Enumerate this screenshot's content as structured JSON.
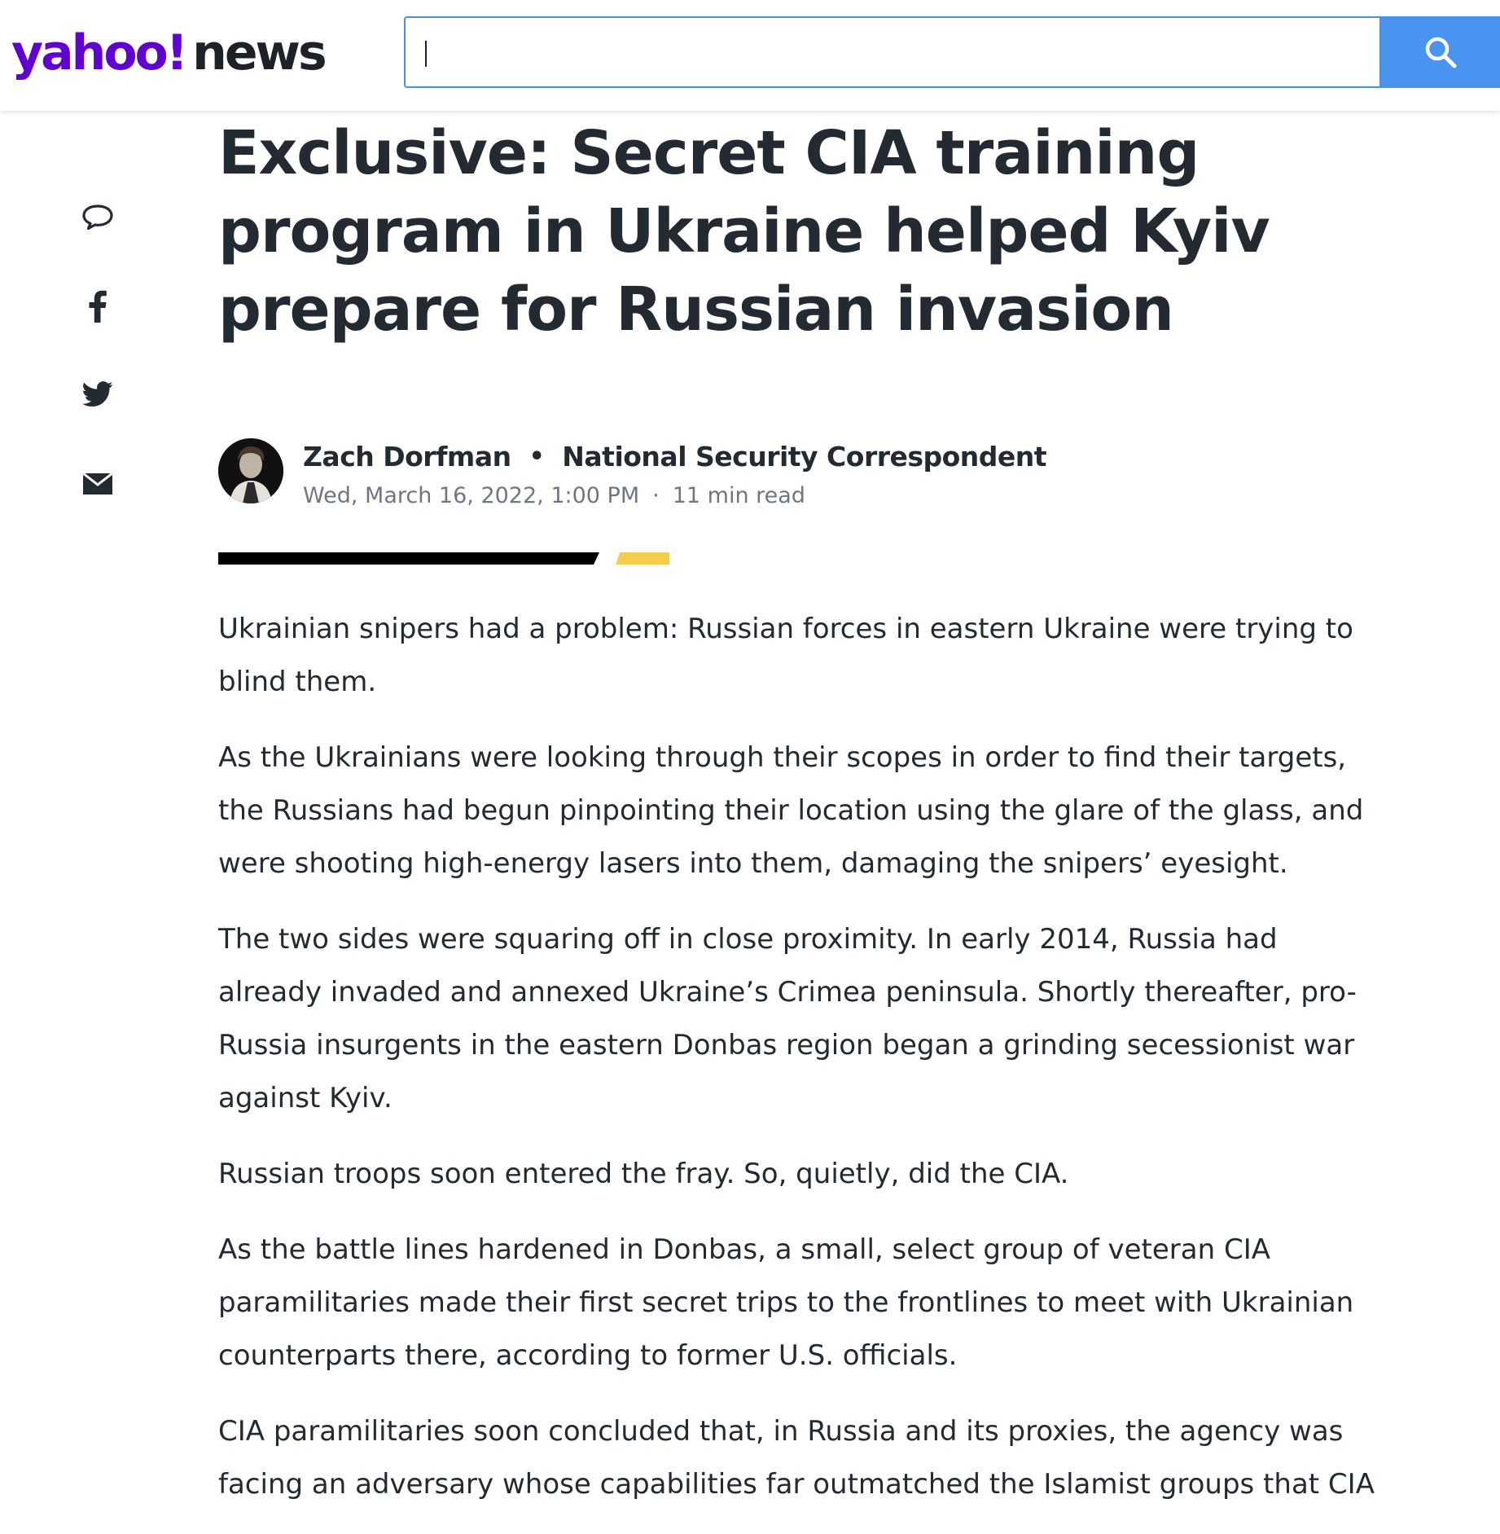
{
  "header": {
    "logo_brand": "yahoo!",
    "logo_section": "news",
    "search": {
      "value": "",
      "placeholder": ""
    },
    "search_icon": "search-icon"
  },
  "share_rail": {
    "items": [
      {
        "icon": "comment-icon"
      },
      {
        "icon": "facebook-icon"
      },
      {
        "icon": "twitter-icon"
      },
      {
        "icon": "email-icon"
      }
    ]
  },
  "article": {
    "headline": "Exclusive: Secret CIA training program in Ukraine helped Kyiv prepare for Russian invasion",
    "author": {
      "name": "Zach Dorfman",
      "title": "National Security Correspondent",
      "avatar": "author-avatar"
    },
    "meta": {
      "date": "Wed, March 16, 2022, 1:00 PM",
      "read_time": "11 min read"
    },
    "paragraphs": [
      "Ukrainian snipers had a problem: Russian forces in eastern Ukraine were trying to blind them.",
      "As the Ukrainians were looking through their scopes in order to find their targets, the Russians had begun pinpointing their location using the glare of the glass, and were shooting high-energy lasers into them, damaging the snipers’ eyesight.",
      "The two sides were squaring off in close proximity. In early 2014, Russia had already invaded and annexed Ukraine’s Crimea peninsula. Shortly thereafter, pro-Russia insurgents in the eastern Donbas region began a grinding secessionist war against Kyiv.",
      "Russian troops soon entered the fray. So, quietly, did the CIA.",
      "As the battle lines hardened in Donbas, a small, select group of veteran CIA paramilitaries made their first secret trips to the frontlines to meet with Ukrainian counterparts there, according to former U.S. officials.",
      "CIA paramilitaries soon concluded that, in Russia and its proxies, the agency was facing an adversary whose capabilities far outmatched the Islamist groups that CIA"
    ]
  },
  "colors": {
    "brand_purple": "#6001d2",
    "search_blue": "#4a94f1",
    "search_border": "#4a90e2",
    "text_dark": "#232a31",
    "meta_gray": "#6e7780",
    "divider_black": "#000000",
    "divider_yellow": "#f5cb4c"
  }
}
